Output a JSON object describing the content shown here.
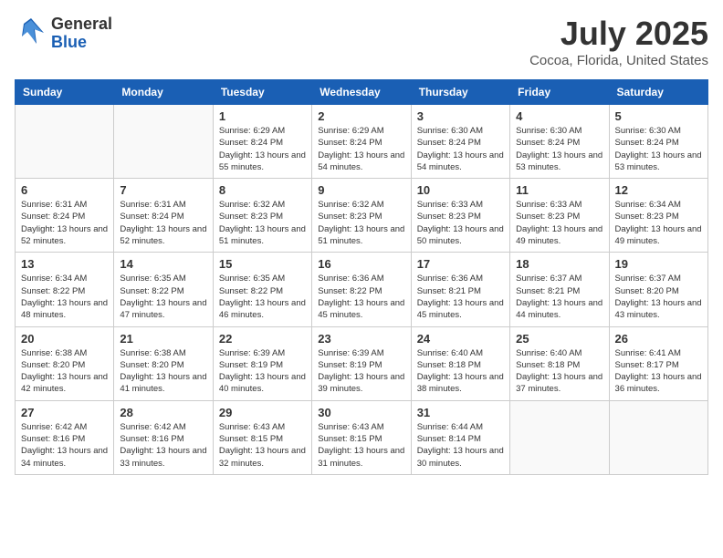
{
  "header": {
    "logo_general": "General",
    "logo_blue": "Blue",
    "title": "July 2025",
    "location": "Cocoa, Florida, United States"
  },
  "weekdays": [
    "Sunday",
    "Monday",
    "Tuesday",
    "Wednesday",
    "Thursday",
    "Friday",
    "Saturday"
  ],
  "weeks": [
    [
      {
        "day": "",
        "info": ""
      },
      {
        "day": "",
        "info": ""
      },
      {
        "day": "1",
        "info": "Sunrise: 6:29 AM\nSunset: 8:24 PM\nDaylight: 13 hours and 55 minutes."
      },
      {
        "day": "2",
        "info": "Sunrise: 6:29 AM\nSunset: 8:24 PM\nDaylight: 13 hours and 54 minutes."
      },
      {
        "day": "3",
        "info": "Sunrise: 6:30 AM\nSunset: 8:24 PM\nDaylight: 13 hours and 54 minutes."
      },
      {
        "day": "4",
        "info": "Sunrise: 6:30 AM\nSunset: 8:24 PM\nDaylight: 13 hours and 53 minutes."
      },
      {
        "day": "5",
        "info": "Sunrise: 6:30 AM\nSunset: 8:24 PM\nDaylight: 13 hours and 53 minutes."
      }
    ],
    [
      {
        "day": "6",
        "info": "Sunrise: 6:31 AM\nSunset: 8:24 PM\nDaylight: 13 hours and 52 minutes."
      },
      {
        "day": "7",
        "info": "Sunrise: 6:31 AM\nSunset: 8:24 PM\nDaylight: 13 hours and 52 minutes."
      },
      {
        "day": "8",
        "info": "Sunrise: 6:32 AM\nSunset: 8:23 PM\nDaylight: 13 hours and 51 minutes."
      },
      {
        "day": "9",
        "info": "Sunrise: 6:32 AM\nSunset: 8:23 PM\nDaylight: 13 hours and 51 minutes."
      },
      {
        "day": "10",
        "info": "Sunrise: 6:33 AM\nSunset: 8:23 PM\nDaylight: 13 hours and 50 minutes."
      },
      {
        "day": "11",
        "info": "Sunrise: 6:33 AM\nSunset: 8:23 PM\nDaylight: 13 hours and 49 minutes."
      },
      {
        "day": "12",
        "info": "Sunrise: 6:34 AM\nSunset: 8:23 PM\nDaylight: 13 hours and 49 minutes."
      }
    ],
    [
      {
        "day": "13",
        "info": "Sunrise: 6:34 AM\nSunset: 8:22 PM\nDaylight: 13 hours and 48 minutes."
      },
      {
        "day": "14",
        "info": "Sunrise: 6:35 AM\nSunset: 8:22 PM\nDaylight: 13 hours and 47 minutes."
      },
      {
        "day": "15",
        "info": "Sunrise: 6:35 AM\nSunset: 8:22 PM\nDaylight: 13 hours and 46 minutes."
      },
      {
        "day": "16",
        "info": "Sunrise: 6:36 AM\nSunset: 8:22 PM\nDaylight: 13 hours and 45 minutes."
      },
      {
        "day": "17",
        "info": "Sunrise: 6:36 AM\nSunset: 8:21 PM\nDaylight: 13 hours and 45 minutes."
      },
      {
        "day": "18",
        "info": "Sunrise: 6:37 AM\nSunset: 8:21 PM\nDaylight: 13 hours and 44 minutes."
      },
      {
        "day": "19",
        "info": "Sunrise: 6:37 AM\nSunset: 8:20 PM\nDaylight: 13 hours and 43 minutes."
      }
    ],
    [
      {
        "day": "20",
        "info": "Sunrise: 6:38 AM\nSunset: 8:20 PM\nDaylight: 13 hours and 42 minutes."
      },
      {
        "day": "21",
        "info": "Sunrise: 6:38 AM\nSunset: 8:20 PM\nDaylight: 13 hours and 41 minutes."
      },
      {
        "day": "22",
        "info": "Sunrise: 6:39 AM\nSunset: 8:19 PM\nDaylight: 13 hours and 40 minutes."
      },
      {
        "day": "23",
        "info": "Sunrise: 6:39 AM\nSunset: 8:19 PM\nDaylight: 13 hours and 39 minutes."
      },
      {
        "day": "24",
        "info": "Sunrise: 6:40 AM\nSunset: 8:18 PM\nDaylight: 13 hours and 38 minutes."
      },
      {
        "day": "25",
        "info": "Sunrise: 6:40 AM\nSunset: 8:18 PM\nDaylight: 13 hours and 37 minutes."
      },
      {
        "day": "26",
        "info": "Sunrise: 6:41 AM\nSunset: 8:17 PM\nDaylight: 13 hours and 36 minutes."
      }
    ],
    [
      {
        "day": "27",
        "info": "Sunrise: 6:42 AM\nSunset: 8:16 PM\nDaylight: 13 hours and 34 minutes."
      },
      {
        "day": "28",
        "info": "Sunrise: 6:42 AM\nSunset: 8:16 PM\nDaylight: 13 hours and 33 minutes."
      },
      {
        "day": "29",
        "info": "Sunrise: 6:43 AM\nSunset: 8:15 PM\nDaylight: 13 hours and 32 minutes."
      },
      {
        "day": "30",
        "info": "Sunrise: 6:43 AM\nSunset: 8:15 PM\nDaylight: 13 hours and 31 minutes."
      },
      {
        "day": "31",
        "info": "Sunrise: 6:44 AM\nSunset: 8:14 PM\nDaylight: 13 hours and 30 minutes."
      },
      {
        "day": "",
        "info": ""
      },
      {
        "day": "",
        "info": ""
      }
    ]
  ]
}
